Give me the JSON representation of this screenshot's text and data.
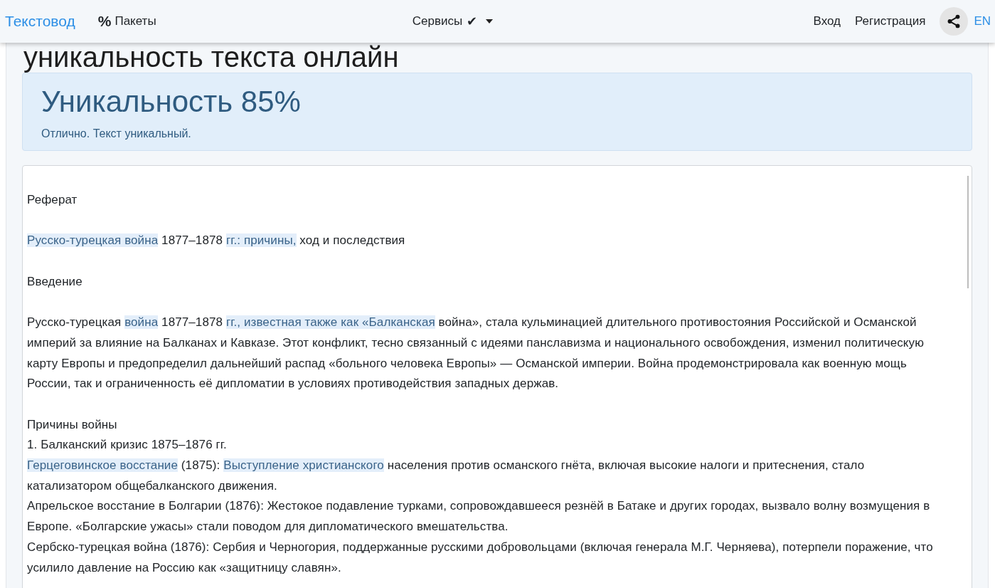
{
  "navbar": {
    "logo": "Текстовод",
    "packages_icon": "%",
    "packages": "Пакеты",
    "services": "Сервисы",
    "services_check": "✔",
    "login": "Вход",
    "register": "Регистрация",
    "language": "EN"
  },
  "page_heading": "уникальность текста онлайн",
  "result": {
    "title": "Уникальность 85%",
    "message": "Отлично. Текст уникальный."
  },
  "body": {
    "groups": [
      {
        "lines": [
          {
            "text": "Реферат"
          }
        ]
      },
      {
        "lines": [
          {
            "segments": [
              {
                "text": "Русско-турецкая ",
                "highlighted": true
              },
              {
                "text": "война",
                "highlighted": true
              },
              {
                "text": " 1877–1878 ",
                "highlighted": false
              },
              {
                "text": "гг.: ",
                "highlighted": true
              },
              {
                "text": "причины,",
                "highlighted": true
              },
              {
                "text": " ход и последствия",
                "highlighted": false
              }
            ]
          }
        ]
      },
      {
        "lines": [
          {
            "text": "Введение"
          }
        ]
      },
      {
        "lines": [
          {
            "segments": [
              {
                "text": "Русско-турецкая ",
                "highlighted": false
              },
              {
                "text": "война",
                "highlighted": true
              },
              {
                "text": " 1877–1878 ",
                "highlighted": false
              },
              {
                "text": "гг., ",
                "highlighted": true
              },
              {
                "text": "известная ",
                "highlighted": true
              },
              {
                "text": "также ",
                "highlighted": true
              },
              {
                "text": "как ",
                "highlighted": true
              },
              {
                "text": "«Балканская",
                "highlighted": true
              },
              {
                "text": " война», стала кульминацией длительного противостояния Российской и Османской империй за влияние на Балканах и Кавказе. Этот конфликт, тесно связанный с идеями панславизма и национального освобождения, изменил политическую карту Европы и предопределил дальнейший распад «больного человека Европы» — Османской империи. Война продемонстрировала как военную мощь России, так и ограниченность её дипломатии в условиях противодействия западных держав.",
                "highlighted": false
              }
            ]
          }
        ]
      },
      {
        "lines": [
          {
            "text": "Причины войны"
          },
          {
            "text": "1. Балканский кризис 1875–1876 гг."
          },
          {
            "segments": [
              {
                "text": "Герцеговинское ",
                "highlighted": true
              },
              {
                "text": "восстание",
                "highlighted": true
              },
              {
                "text": " (1875): ",
                "highlighted": false
              },
              {
                "text": "Выступление ",
                "highlighted": true
              },
              {
                "text": "христианского",
                "highlighted": true
              },
              {
                "text": " населения против османского гнёта, включая высокие налоги и притеснения, стало катализатором общебалканского движения.",
                "highlighted": false
              }
            ]
          },
          {
            "text": "Апрельское восстание в Болгарии (1876): Жестокое подавление турками, сопровождавшееся резнёй в Батаке и других городах, вызвало волну возмущения в Европе. «Болгарские ужасы» стали поводом для дипломатического вмешательства."
          },
          {
            "text": "Сербско-турецкая война (1876): Сербия и Черногория, поддержанные русскими добровольцами (включая генерала М.Г. Черняева), потерпели поражение, что усилило давление на Россию как «защитницу славян»."
          }
        ]
      }
    ]
  }
}
